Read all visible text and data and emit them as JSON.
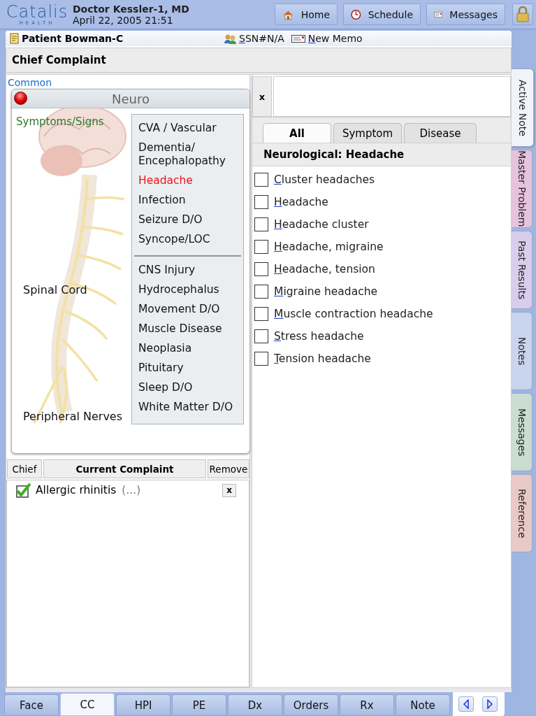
{
  "header": {
    "logo_main": "Catalis",
    "logo_sub": "HEALTH",
    "user": "Doctor Kessler-1, MD",
    "datetime": "April 22, 2005 21:51",
    "buttons": [
      {
        "kind": "home",
        "label": "Home"
      },
      {
        "kind": "schedule",
        "label": "Schedule"
      },
      {
        "kind": "messages",
        "label": "Messages"
      },
      {
        "kind": "lock"
      }
    ]
  },
  "patient": {
    "name": "Patient Bowman-C",
    "ssn": "SSN#N/A",
    "memo": "New Memo"
  },
  "section_title": "Chief Complaint",
  "categories": [
    {
      "label": "Common"
    }
  ],
  "neuro_popup": {
    "title": "Neuro",
    "subtitle": "Symptoms/Signs",
    "labels": [
      "Spinal Cord",
      "Peripheral Nerves"
    ],
    "menu_groups": [
      [
        {
          "label": "CVA / Vascular",
          "selected": false
        },
        {
          "label": "Dementia/\nEncephalopathy",
          "selected": false
        },
        {
          "label": "Headache",
          "selected": true
        },
        {
          "label": "Infection",
          "selected": false
        },
        {
          "label": "Seizure D/O",
          "selected": false
        },
        {
          "label": "Syncope/LOC",
          "selected": false
        }
      ],
      [
        {
          "label": "CNS Injury",
          "selected": false
        },
        {
          "label": "Hydrocephalus",
          "selected": false
        },
        {
          "label": "Movement D/O",
          "selected": false
        },
        {
          "label": "Muscle Disease",
          "selected": false
        },
        {
          "label": "Neoplasia",
          "selected": false
        },
        {
          "label": "Pituitary",
          "selected": false
        },
        {
          "label": "Sleep D/O",
          "selected": false
        },
        {
          "label": "White Matter D/O",
          "selected": false
        }
      ]
    ]
  },
  "complaints": {
    "columns": [
      "Chief",
      "Current Complaint",
      "Remove"
    ],
    "rows": [
      {
        "checked": true,
        "name": "Allergic rhinitis",
        "detail": "(…)",
        "remove": "x"
      }
    ]
  },
  "finder": {
    "clear_button": "x",
    "tabs": [
      {
        "label": "All",
        "selected": true
      },
      {
        "label": "Symptom",
        "selected": false
      },
      {
        "label": "Disease",
        "selected": false
      }
    ],
    "list_title": "Neurological: Headache",
    "items": [
      {
        "label": "Cluster headaches",
        "checked": false
      },
      {
        "label": "Headache",
        "checked": false
      },
      {
        "label": "Headache cluster",
        "checked": false
      },
      {
        "label": "Headache, migraine",
        "checked": false
      },
      {
        "label": "Headache, tension",
        "checked": false
      },
      {
        "label": "Migraine headache",
        "checked": false
      },
      {
        "label": "Muscle contraction headache",
        "checked": false
      },
      {
        "label": "Stress headache",
        "checked": false
      },
      {
        "label": "Tension headache",
        "checked": false
      }
    ]
  },
  "side_tabs": [
    {
      "label": "Active Note",
      "selected": true,
      "color": "#f2f3f9"
    },
    {
      "label": "Master Problem",
      "selected": false,
      "color": "#e6c3dc"
    },
    {
      "label": "Past Results",
      "selected": false,
      "color": "#d9cdec"
    },
    {
      "label": "Notes",
      "selected": false,
      "color": "#c9d5ec"
    },
    {
      "label": "Messages",
      "selected": false,
      "color": "#c9ddd0"
    },
    {
      "label": "Reference",
      "selected": false,
      "color": "#e9c9c6"
    }
  ],
  "bottom_tabs": [
    {
      "label": "Face",
      "selected": false
    },
    {
      "label": "CC",
      "selected": true
    },
    {
      "label": "HPI",
      "selected": false
    },
    {
      "label": "PE",
      "selected": false
    },
    {
      "label": "Dx",
      "selected": false
    },
    {
      "label": "Orders",
      "selected": false
    },
    {
      "label": "Rx",
      "selected": false
    },
    {
      "label": "Note",
      "selected": false
    }
  ]
}
